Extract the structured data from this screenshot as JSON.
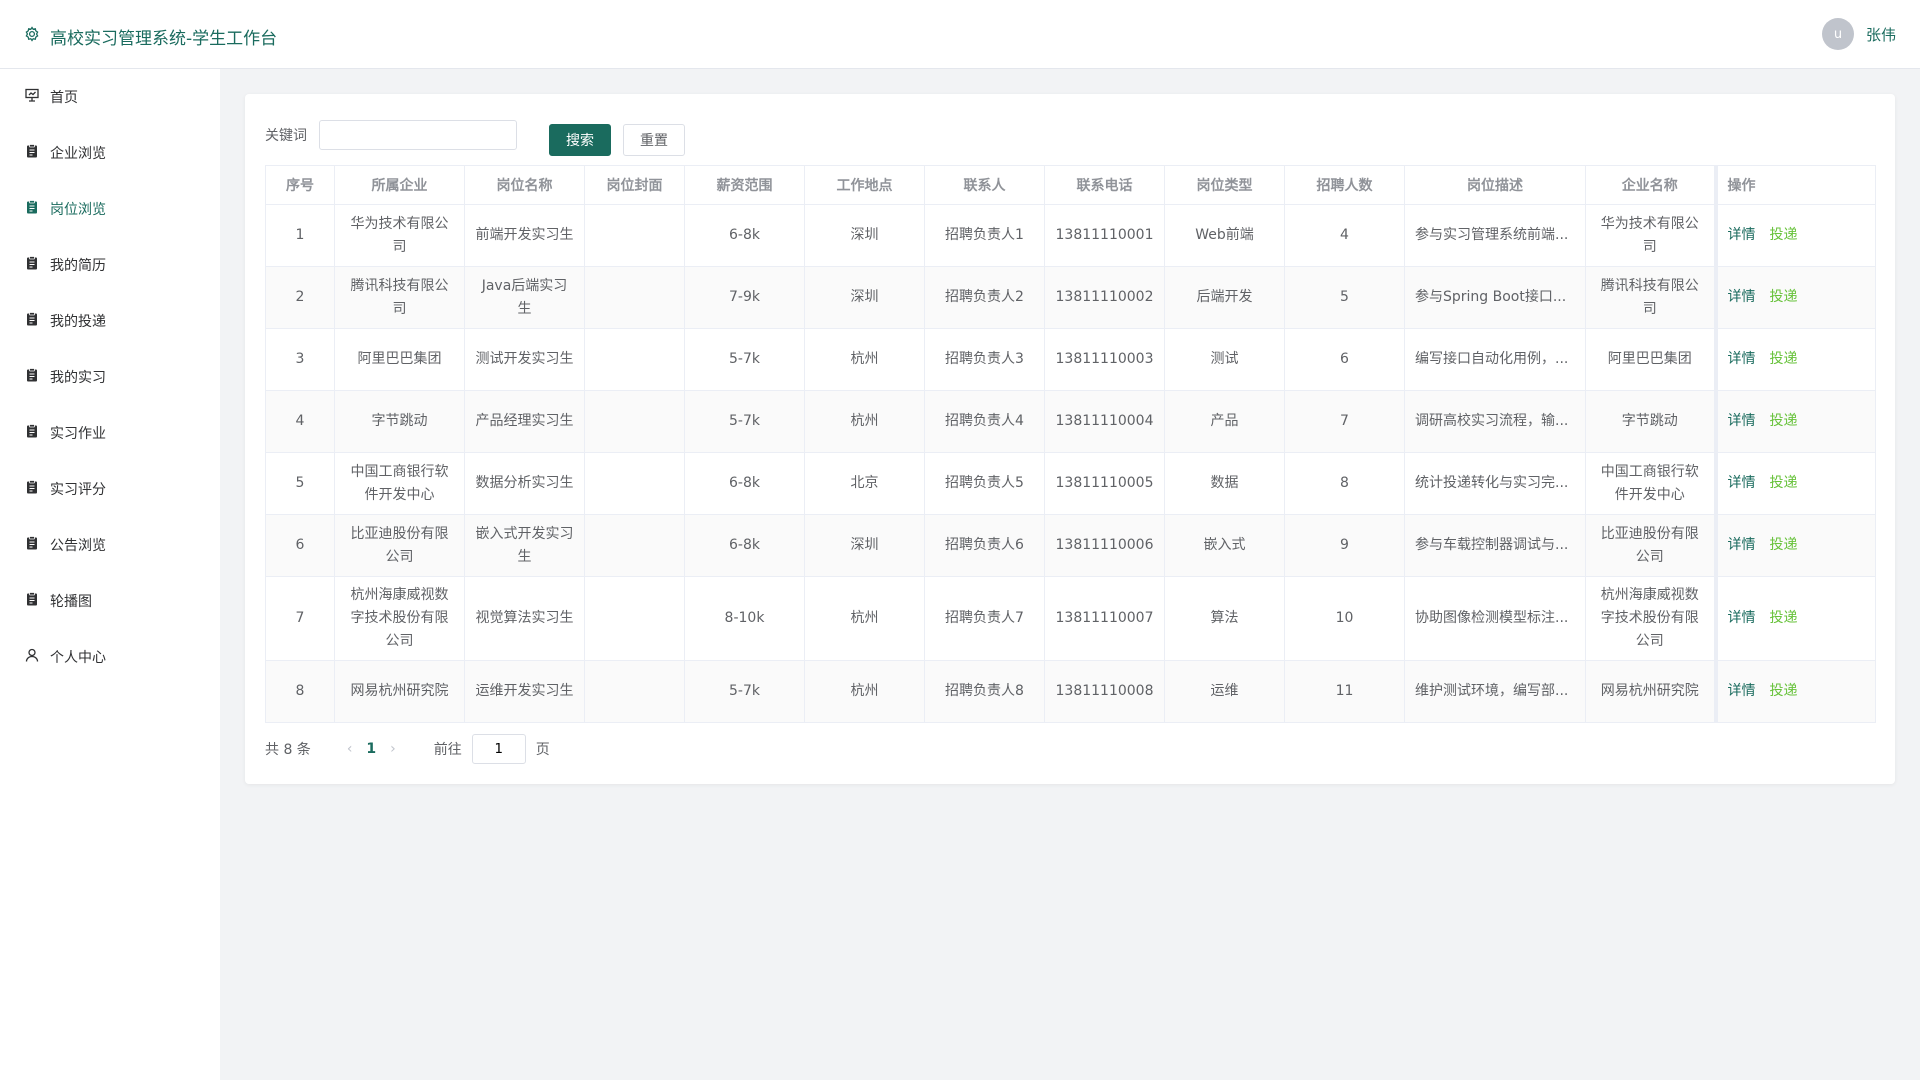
{
  "app": {
    "title": "高校实习管理系统-学生工作台"
  },
  "user": {
    "avatar_letter": "u",
    "name": "张伟"
  },
  "sidebar": {
    "items": [
      {
        "label": "首页",
        "icon": "presentation-icon"
      },
      {
        "label": "企业浏览",
        "icon": "clipboard-icon"
      },
      {
        "label": "岗位浏览",
        "icon": "clipboard-icon",
        "active": true
      },
      {
        "label": "我的简历",
        "icon": "clipboard-icon"
      },
      {
        "label": "我的投递",
        "icon": "clipboard-icon"
      },
      {
        "label": "我的实习",
        "icon": "clipboard-icon"
      },
      {
        "label": "实习作业",
        "icon": "clipboard-icon"
      },
      {
        "label": "实习评分",
        "icon": "clipboard-icon"
      },
      {
        "label": "公告浏览",
        "icon": "clipboard-icon"
      },
      {
        "label": "轮播图",
        "icon": "clipboard-icon"
      },
      {
        "label": "个人中心",
        "icon": "user-icon"
      }
    ]
  },
  "search": {
    "label": "关键词",
    "value": "",
    "search_label": "搜索",
    "reset_label": "重置"
  },
  "table": {
    "headers": [
      "序号",
      "所属企业",
      "岗位名称",
      "岗位封面",
      "薪资范围",
      "工作地点",
      "联系人",
      "联系电话",
      "岗位类型",
      "招聘人数",
      "岗位描述",
      "企业名称",
      "操作"
    ],
    "rows": [
      [
        "1",
        "华为技术有限公司",
        "前端开发实习生",
        "",
        "6-8k",
        "深圳",
        "招聘负责人1",
        "13811110001",
        "Web前端",
        "4",
        "参与实习管理系统前端...",
        "华为技术有限公司"
      ],
      [
        "2",
        "腾讯科技有限公司",
        "Java后端实习生",
        "",
        "7-9k",
        "深圳",
        "招聘负责人2",
        "13811110002",
        "后端开发",
        "5",
        "参与Spring Boot接口...",
        "腾讯科技有限公司"
      ],
      [
        "3",
        "阿里巴巴集团",
        "测试开发实习生",
        "",
        "5-7k",
        "杭州",
        "招聘负责人3",
        "13811110003",
        "测试",
        "6",
        "编写接口自动化用例，...",
        "阿里巴巴集团"
      ],
      [
        "4",
        "字节跳动",
        "产品经理实习生",
        "",
        "5-7k",
        "杭州",
        "招聘负责人4",
        "13811110004",
        "产品",
        "7",
        "调研高校实习流程，输...",
        "字节跳动"
      ],
      [
        "5",
        "中国工商银行软件开发中心",
        "数据分析实习生",
        "",
        "6-8k",
        "北京",
        "招聘负责人5",
        "13811110005",
        "数据",
        "8",
        "统计投递转化与实习完...",
        "中国工商银行软件开发中心"
      ],
      [
        "6",
        "比亚迪股份有限公司",
        "嵌入式开发实习生",
        "",
        "6-8k",
        "深圳",
        "招聘负责人6",
        "13811110006",
        "嵌入式",
        "9",
        "参与车载控制器调试与...",
        "比亚迪股份有限公司"
      ],
      [
        "7",
        "杭州海康威视数字技术股份有限公司",
        "视觉算法实习生",
        "",
        "8-10k",
        "杭州",
        "招聘负责人7",
        "13811110007",
        "算法",
        "10",
        "协助图像检测模型标注...",
        "杭州海康威视数字技术股份有限公司"
      ],
      [
        "8",
        "网易杭州研究院",
        "运维开发实习生",
        "",
        "5-7k",
        "杭州",
        "招聘负责人8",
        "13811110008",
        "运维",
        "11",
        "维护测试环境，编写部...",
        "网易杭州研究院"
      ]
    ],
    "action_detail": "详情",
    "action_apply": "投递"
  },
  "pagination": {
    "total": "共 8 条",
    "prev": "‹",
    "current": "1",
    "next": "›",
    "goto_label": "前往",
    "goto_value": "1",
    "page_suffix": "页"
  },
  "colors": {
    "accent": "#1a6b5e",
    "apply": "#67c23a"
  }
}
